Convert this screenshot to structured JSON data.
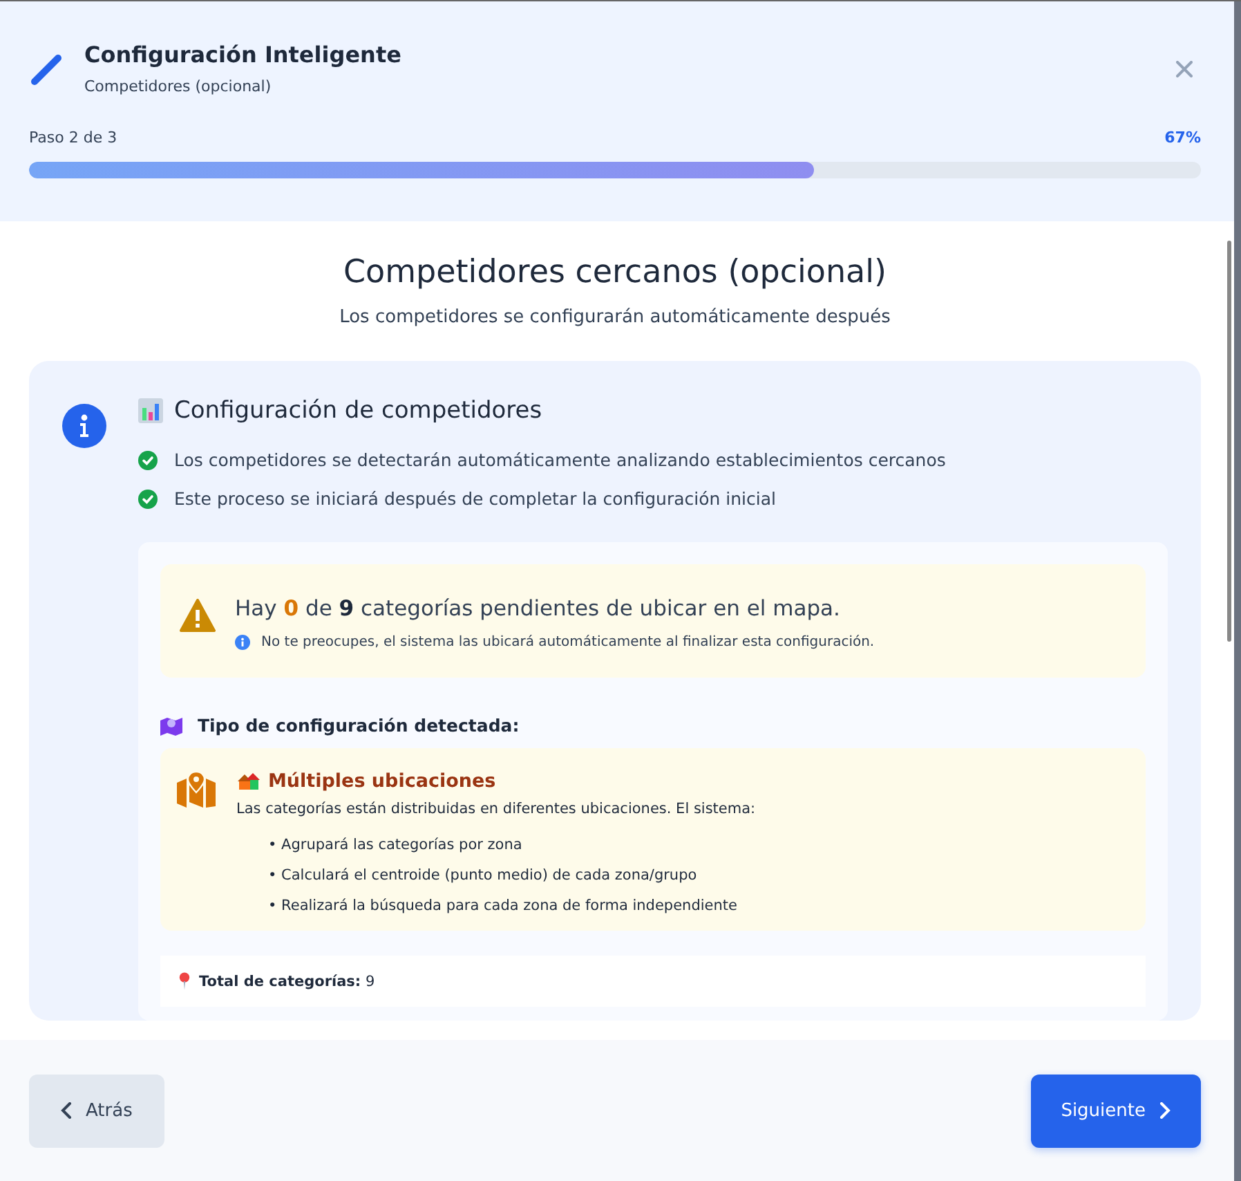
{
  "header": {
    "title": "Configuración Inteligente",
    "subtitle": "Competidores (opcional)",
    "step": "Paso 2 de 3",
    "percent": "67%",
    "level": 0.67
  },
  "section": {
    "title": "Competidores cercanos (opcional)",
    "subtitle": "Los competidores se configurarán automáticamente después"
  },
  "info_card": {
    "heading": "Configuración de competidores",
    "points": [
      "Los competidores se detectarán automáticamente analizando establecimientos cercanos",
      "Este proceso se iniciará después de completar la configuración inicial"
    ]
  },
  "alert": {
    "message": "Hay **0** de **9** categorías pendientes de ubicar en el mapa.",
    "note": "No te preocupes, el sistema las ubicará automáticamente al finalizar esta configuración."
  },
  "config_type": {
    "label": "Tipo de configuración detectada:",
    "title": "Múltiples ubicaciones",
    "description": "Las categorías están distribuidas en diferentes ubicaciones. El sistema:",
    "steps": [
      "• Agrupará las categorías por zona",
      "• Calculará el centroide (punto medio) de cada zona/grupo",
      "• Realizará la búsqueda para cada zona de forma independiente"
    ]
  },
  "summary": {
    "total": "**Total de categorías:** 9"
  },
  "footer": {
    "back": "Atrás",
    "next": "Siguiente"
  }
}
